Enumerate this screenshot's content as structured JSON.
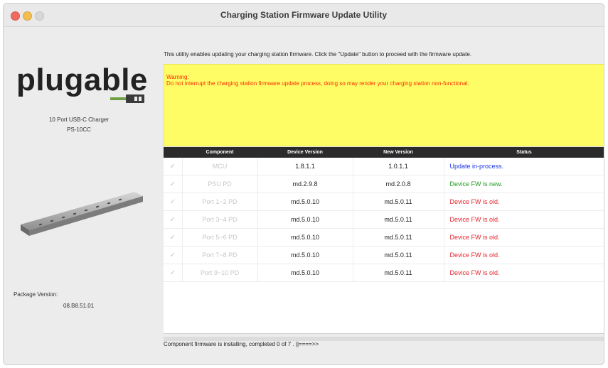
{
  "window": {
    "title": "Charging Station Firmware Update Utility"
  },
  "sidebar": {
    "logo_text": "plugable",
    "product_name": "10 Port USB-C Charger",
    "product_model": "PS-10CC",
    "package_label": "Package Version:",
    "package_value": "08.B8.51.01"
  },
  "main": {
    "intro": "This utility enables updating your charging station firmware. Click the \"Update\" button to proceed with the firmware update.",
    "warning_title": "Warning:",
    "warning_text": "Do not interrupt the charging station firmware update process, doing so may render your charging station non-functional.",
    "table": {
      "headers": [
        "",
        "Component",
        "Device Version",
        "New Version",
        "Status"
      ],
      "rows": [
        {
          "check": "✓",
          "component": "MCU",
          "device": "1.8.1.1",
          "new": "1.0.1.1",
          "status": "Update in-process."
        },
        {
          "check": "✓",
          "component": "PSU PD",
          "device": "md.2.9.8",
          "new": "md.2.0.8",
          "status": "Device FW is new."
        },
        {
          "check": "✓",
          "component": "Port 1~2 PD",
          "device": "md.5.0.10",
          "new": "md.5.0.11",
          "status": "Device FW is old."
        },
        {
          "check": "✓",
          "component": "Port 3~4 PD",
          "device": "md.5.0.10",
          "new": "md.5.0.11",
          "status": "Device FW is old."
        },
        {
          "check": "✓",
          "component": "Port 5~6 PD",
          "device": "md.5.0.10",
          "new": "md.5.0.11",
          "status": "Device FW is old."
        },
        {
          "check": "✓",
          "component": "Port 7~8 PD",
          "device": "md.5.0.10",
          "new": "md.5.0.11",
          "status": "Device FW is old."
        },
        {
          "check": "✓",
          "component": "Port 9~10 PD",
          "device": "md.5.0.10",
          "new": "md.5.0.11",
          "status": "Device FW is old."
        }
      ]
    },
    "progress_text": "Component firmware is installing, completed 0 of 7 .   ||====>>"
  },
  "colors": {
    "status_in_process": "#1a35e6",
    "status_new": "#1f9e1f",
    "status_old": "#e6262e",
    "warning_bg": "#fffd66",
    "warning_text": "#ff2a00"
  }
}
